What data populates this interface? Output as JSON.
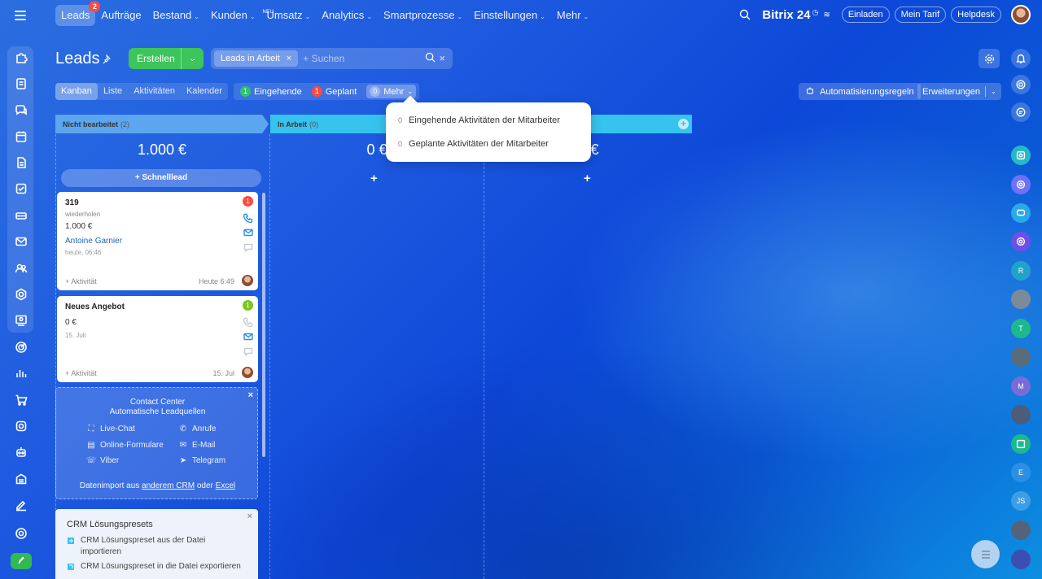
{
  "topnav": {
    "items": [
      {
        "label": "Leads",
        "badge": "2",
        "active": true
      },
      {
        "label": "Aufträge"
      },
      {
        "label": "Bestand",
        "caret": true
      },
      {
        "label": "Kunden",
        "caret": true
      },
      {
        "label": "Umsatz",
        "caret": true,
        "tag": "NEU"
      },
      {
        "label": "Analytics",
        "caret": true
      },
      {
        "label": "Smartprozesse",
        "caret": true
      },
      {
        "label": "Einstellungen",
        "caret": true
      },
      {
        "label": "Mehr",
        "caret": true
      }
    ],
    "brand": "Bitrix 24",
    "invite": "Einladen",
    "tariff": "Mein Tarif",
    "helpdesk": "Helpdesk"
  },
  "header": {
    "title": "Leads",
    "create_label": "Erstellen",
    "filter_chip": "Leads in Arbeit",
    "search_placeholder": "+ Suchen"
  },
  "views": [
    "Kanban",
    "Liste",
    "Aktivitäten",
    "Kalender"
  ],
  "counters": {
    "incoming": {
      "count": "1",
      "label": "Eingehende"
    },
    "planned": {
      "count": "1",
      "label": "Geplant"
    },
    "more": {
      "count": "0",
      "label": "Mehr"
    }
  },
  "automation_label": "Automatisierungsregeln",
  "extensions_label": "Erweiterungen",
  "dropdown": {
    "items": [
      {
        "count": "0",
        "label": "Eingehende Aktivitäten der Mitarbeiter"
      },
      {
        "count": "0",
        "label": "Geplante Aktivitäten der Mitarbeiter"
      }
    ]
  },
  "columns": [
    {
      "title": "Nicht bearbeitet",
      "count": "(2)",
      "sum": "1.000 €",
      "color": "#5ba6ef"
    },
    {
      "title": "In Arbeit",
      "count": "(0)",
      "sum": "0 €",
      "color": "#36c3ee"
    },
    {
      "title": "",
      "count": "",
      "sum": "0 €",
      "color": "#36c3ee"
    }
  ],
  "quick_lead": "Schnelllead",
  "cards": [
    {
      "title": "319",
      "subtitle": "wiederholen",
      "amount": "1.000 €",
      "contact": "Antoine Garnier",
      "date": "heute, 06:46",
      "activity": "+ Aktivität",
      "time": "Heute 6:49",
      "badge": "1",
      "badge_color": "#ff4a3d"
    },
    {
      "title": "Neues Angebot",
      "amount": "0 €",
      "date": "15. Juli",
      "activity": "+ Aktivität",
      "time": "15. Jul",
      "badge": "1",
      "badge_color": "#7bc91b"
    }
  ],
  "contact_center": {
    "title_line1": "Contact Center",
    "title_line2": "Automatische Leadquellen",
    "links": [
      "Live-Chat",
      "Anrufe",
      "Online-Formulare",
      "E-Mail",
      "Viber",
      "Telegram"
    ],
    "import_prefix": "Datenimport aus",
    "import_link1": "anderem CRM",
    "import_mid": "oder",
    "import_link2": "Excel"
  },
  "presets": {
    "title": "CRM Lösungspresets",
    "items": [
      "CRM Lösungspreset aus der Datei importieren",
      "CRM Lösungspreset in die Datei exportieren"
    ]
  },
  "right_sidebar_initials": [
    "R",
    "T",
    "M",
    "E",
    "JS"
  ]
}
